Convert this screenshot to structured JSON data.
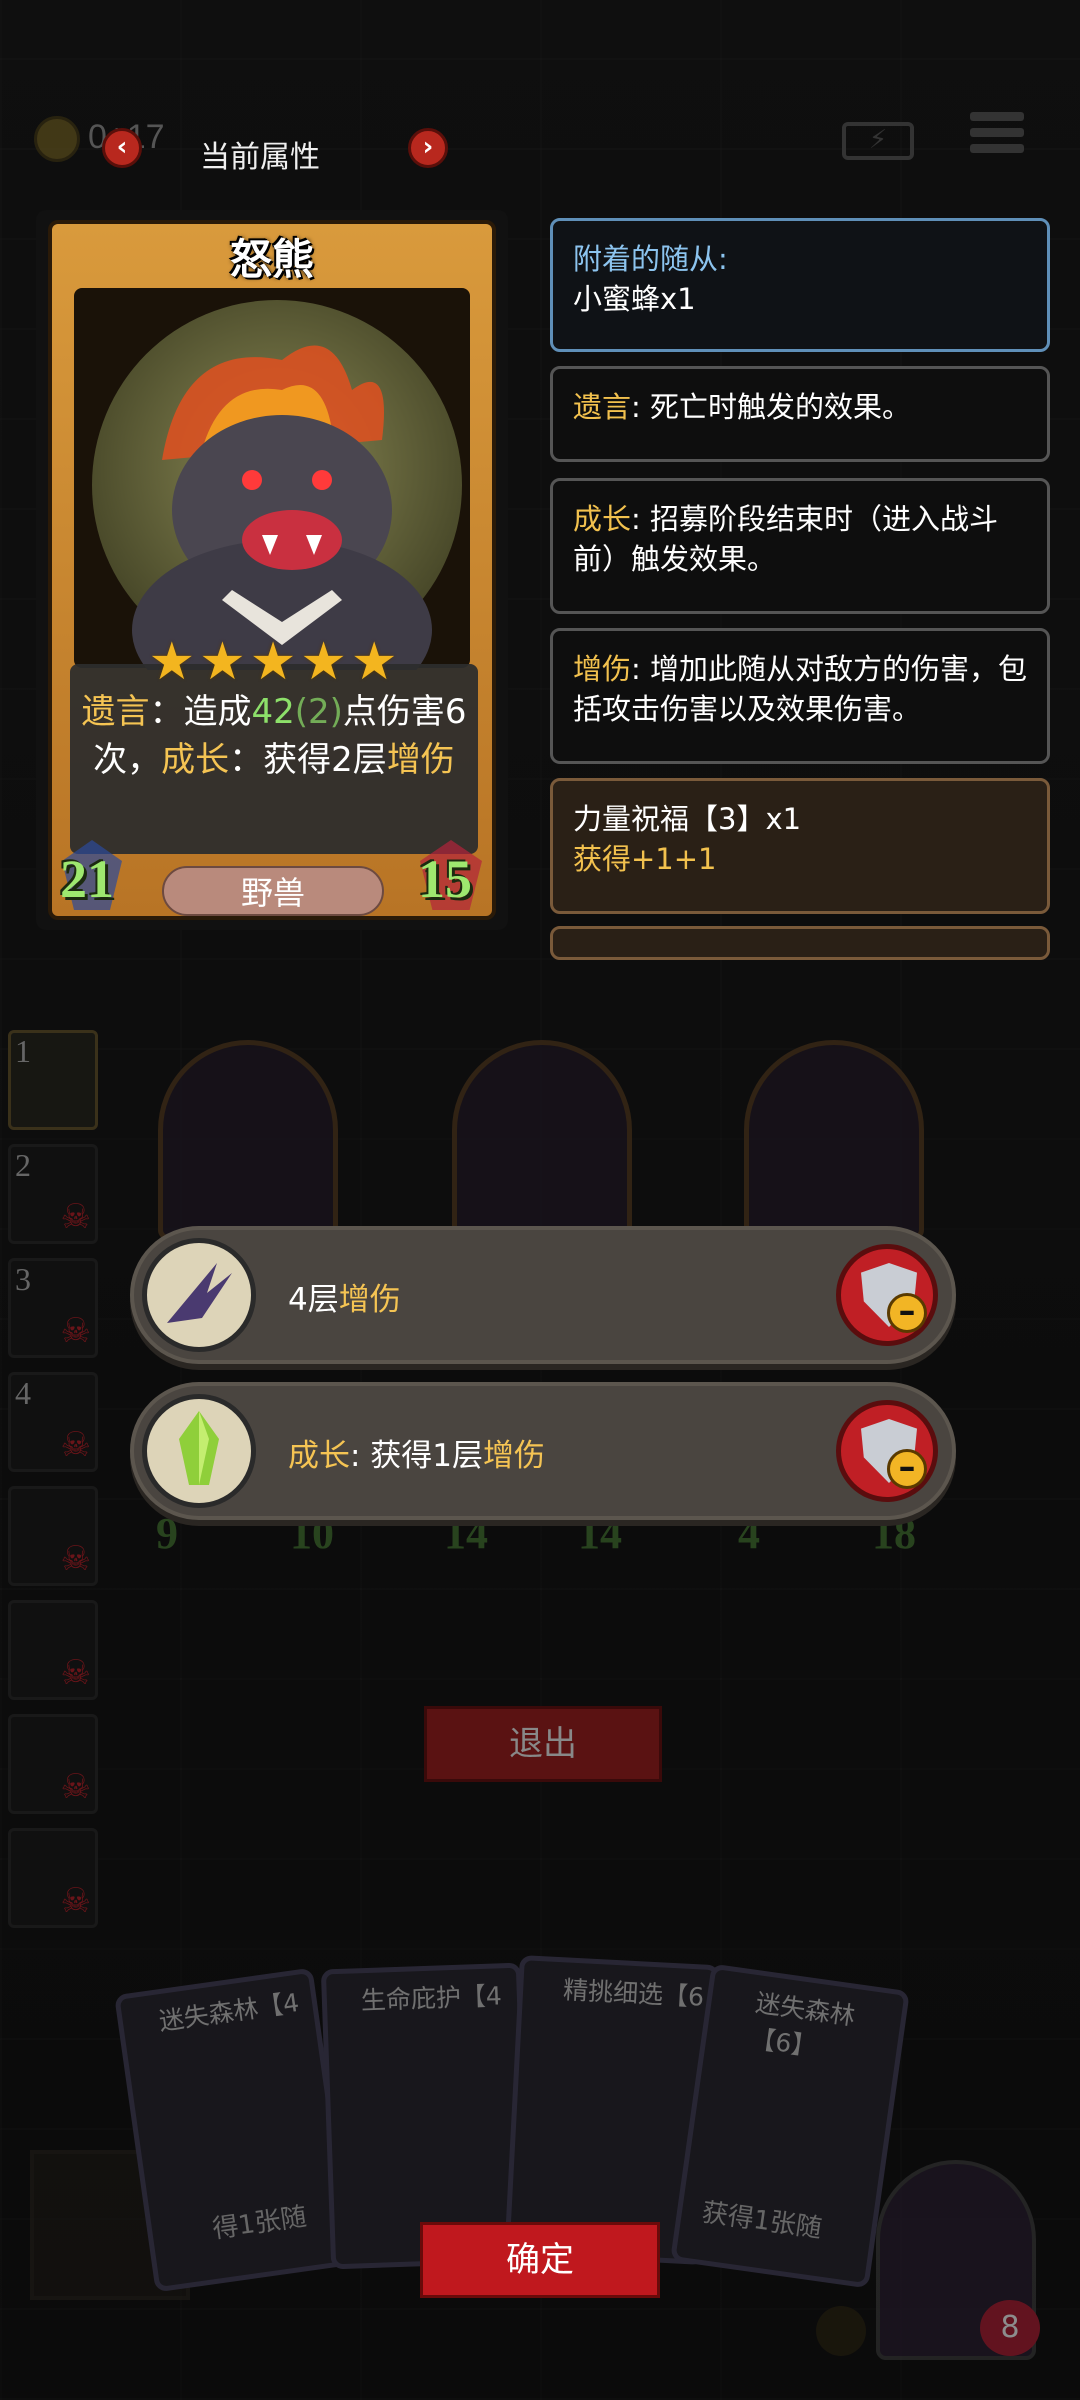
{
  "top_bar": {
    "coin_count": "0+17",
    "title": "当前属性",
    "prev_arrow": "‹",
    "next_arrow": "›"
  },
  "card": {
    "name": "怒熊",
    "stars": "★★★★★",
    "star_count": 5,
    "desc_parts": {
      "p1": "遗言",
      "p2": "：造成",
      "p3": "42",
      "p4": "(2)",
      "p5": "点伤害6次，",
      "p6": "成长",
      "p7": "：获得2层",
      "p8": "增伤"
    },
    "attack": "21",
    "health": "15",
    "tribe": "野兽"
  },
  "info_panels": {
    "attached": {
      "label": "附着的随从:",
      "value": "小蜜蜂x1"
    },
    "deathrattle": {
      "label": "遗言",
      "text": ": 死亡时触发的效果。"
    },
    "growth": {
      "label": "成长",
      "text": ": 招募阶段结束时（进入战斗前）触发效果。"
    },
    "damage_up": {
      "label": "增伤",
      "text": ": 增加此随从对敌方的伤害，包括攻击伤害以及效果伤害。"
    },
    "blessing": {
      "title": "力量祝福【3】x1",
      "effect": "获得+1+1"
    }
  },
  "side_list": [
    "1",
    "2",
    "3",
    "4",
    "",
    "",
    "",
    ""
  ],
  "board_stats": [
    {
      "atk": "9",
      "hp": "10"
    },
    {
      "atk": "14",
      "hp": "14"
    },
    {
      "atk": "4",
      "hp": "18"
    }
  ],
  "effects": [
    {
      "prefix": "4层",
      "keyword": "增伤",
      "suffix": ""
    },
    {
      "prefix": "",
      "keyword": "成长",
      "suffix": ": 获得1层",
      "keyword2": "增伤"
    }
  ],
  "exit_label": "退出",
  "confirm_label": "确定",
  "hand": [
    {
      "title": "迷失森林【4",
      "sub": "得1张随"
    },
    {
      "title": "生命庇护【4",
      "sub": ""
    },
    {
      "title": "精挑细选【6",
      "sub": ""
    },
    {
      "title": "迷失森林【6】",
      "sub": "获得1张随"
    }
  ],
  "player_health": "8"
}
